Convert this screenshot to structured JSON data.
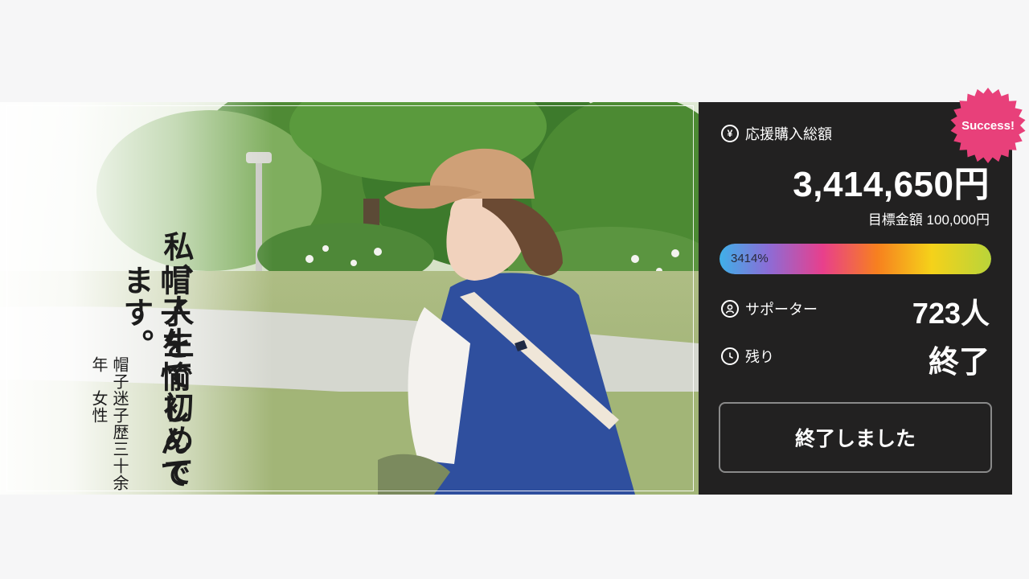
{
  "hero": {
    "headline_line1": "私、人生で初めて",
    "headline_line2": "帽子を愉しんでます。",
    "subcaption": "帽子迷子歴三十余年　女性"
  },
  "stats": {
    "total_label": "応援購入総額",
    "total_icon": "yen-icon",
    "total_amount": "3,414,650円",
    "goal_label": "目標金額 100,000円",
    "progress_percent_text": "3414%",
    "progress_percent": 3414,
    "supporters_label": "サポーター",
    "supporters_icon": "person-icon",
    "supporters_value": "723人",
    "remaining_label": "残り",
    "remaining_icon": "clock-icon",
    "remaining_value": "終了",
    "button_label": "終了しました"
  },
  "badge": {
    "label": "Success!",
    "color": "#e8407a"
  },
  "colors": {
    "panel_bg": "#222121",
    "page_bg": "#f6f6f7",
    "progress_gradient": [
      "#3fb0e8",
      "#8c6cd6",
      "#e83f8c",
      "#f7801f",
      "#f5d21a",
      "#b9d43a"
    ]
  }
}
